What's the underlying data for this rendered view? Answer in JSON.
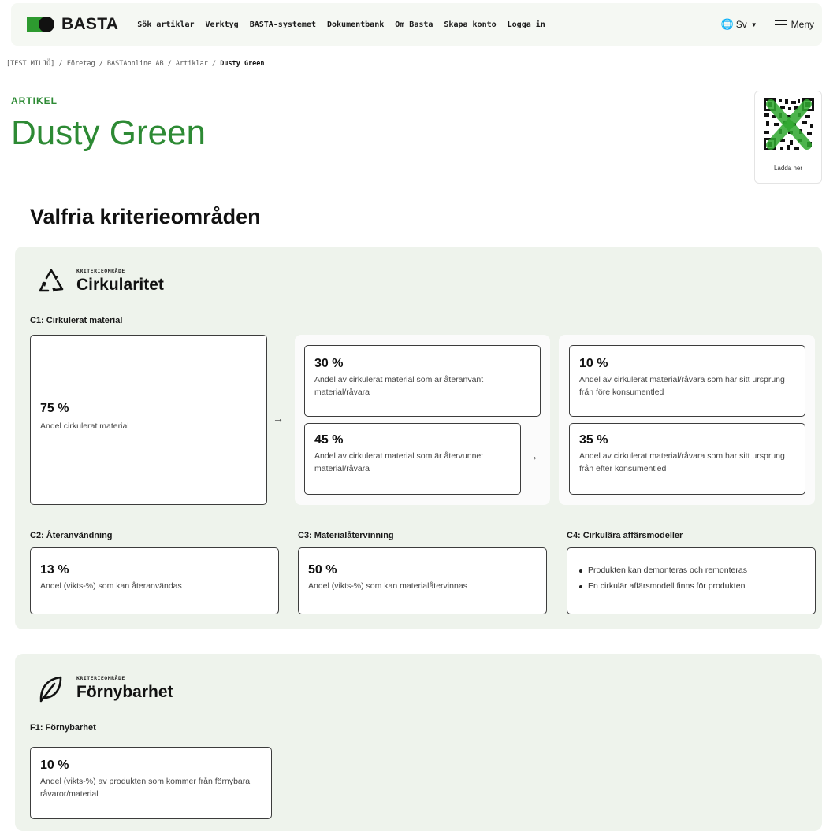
{
  "nav": {
    "logo_text": "BASTA",
    "links": [
      "Sök artiklar",
      "Verktyg",
      "BASTA-systemet",
      "Dokumentbank",
      "Om Basta",
      "Skapa konto",
      "Logga in"
    ],
    "language": "Sv",
    "menu_label": "Meny"
  },
  "breadcrumb": {
    "path": "[TEST MILJÖ] / Företag / BASTAonline AB / Artiklar / ",
    "current": "Dusty Green"
  },
  "article": {
    "kicker": "ARTIKEL",
    "title": "Dusty Green",
    "qr_label": "Ladda ner"
  },
  "section_heading": "Valfria kriterieområden",
  "circularity": {
    "kicker": "KRITERIEOMRÅDE",
    "name": "Cirkularitet",
    "c1": {
      "label": "C1: Cirkulerat material",
      "total": {
        "value": "75 %",
        "desc": "Andel cirkulerat material"
      },
      "reused": {
        "value": "30 %",
        "desc": "Andel av cirkulerat material som är återanvänt material/råvara"
      },
      "recycled": {
        "value": "45 %",
        "desc": "Andel av cirkulerat material som är återvunnet material/råvara"
      },
      "pre_consumer": {
        "value": "10 %",
        "desc": "Andel av cirkulerat material/råvara som har sitt ursprung från före konsumentled"
      },
      "post_consumer": {
        "value": "35 %",
        "desc": "Andel av cirkulerat material/råvara som har sitt ursprung från efter konsumentled"
      }
    },
    "c2": {
      "label": "C2: Återanvändning",
      "value": "13 %",
      "desc": "Andel (vikts-%) som kan återanvändas"
    },
    "c3": {
      "label": "C3: Materialåtervinning",
      "value": "50 %",
      "desc": "Andel (vikts-%) som kan materialåtervinnas"
    },
    "c4": {
      "label": "C4: Cirkulära affärsmodeller",
      "items": [
        "Produkten kan demonteras och remonteras",
        "En cirkulär affärsmodell finns för produkten"
      ]
    }
  },
  "renewability": {
    "kicker": "KRITERIEOMRÅDE",
    "name": "Förnybarhet",
    "f1": {
      "label": "F1: Förnybarhet",
      "value": "10 %",
      "desc": "Andel (vikts-%) av produkten som kommer från förnybara råvaror/material"
    }
  },
  "colors": {
    "brand_green": "#2d8a34",
    "logo_green": "#2d9a2f",
    "panel_bg": "#eef3ec"
  }
}
